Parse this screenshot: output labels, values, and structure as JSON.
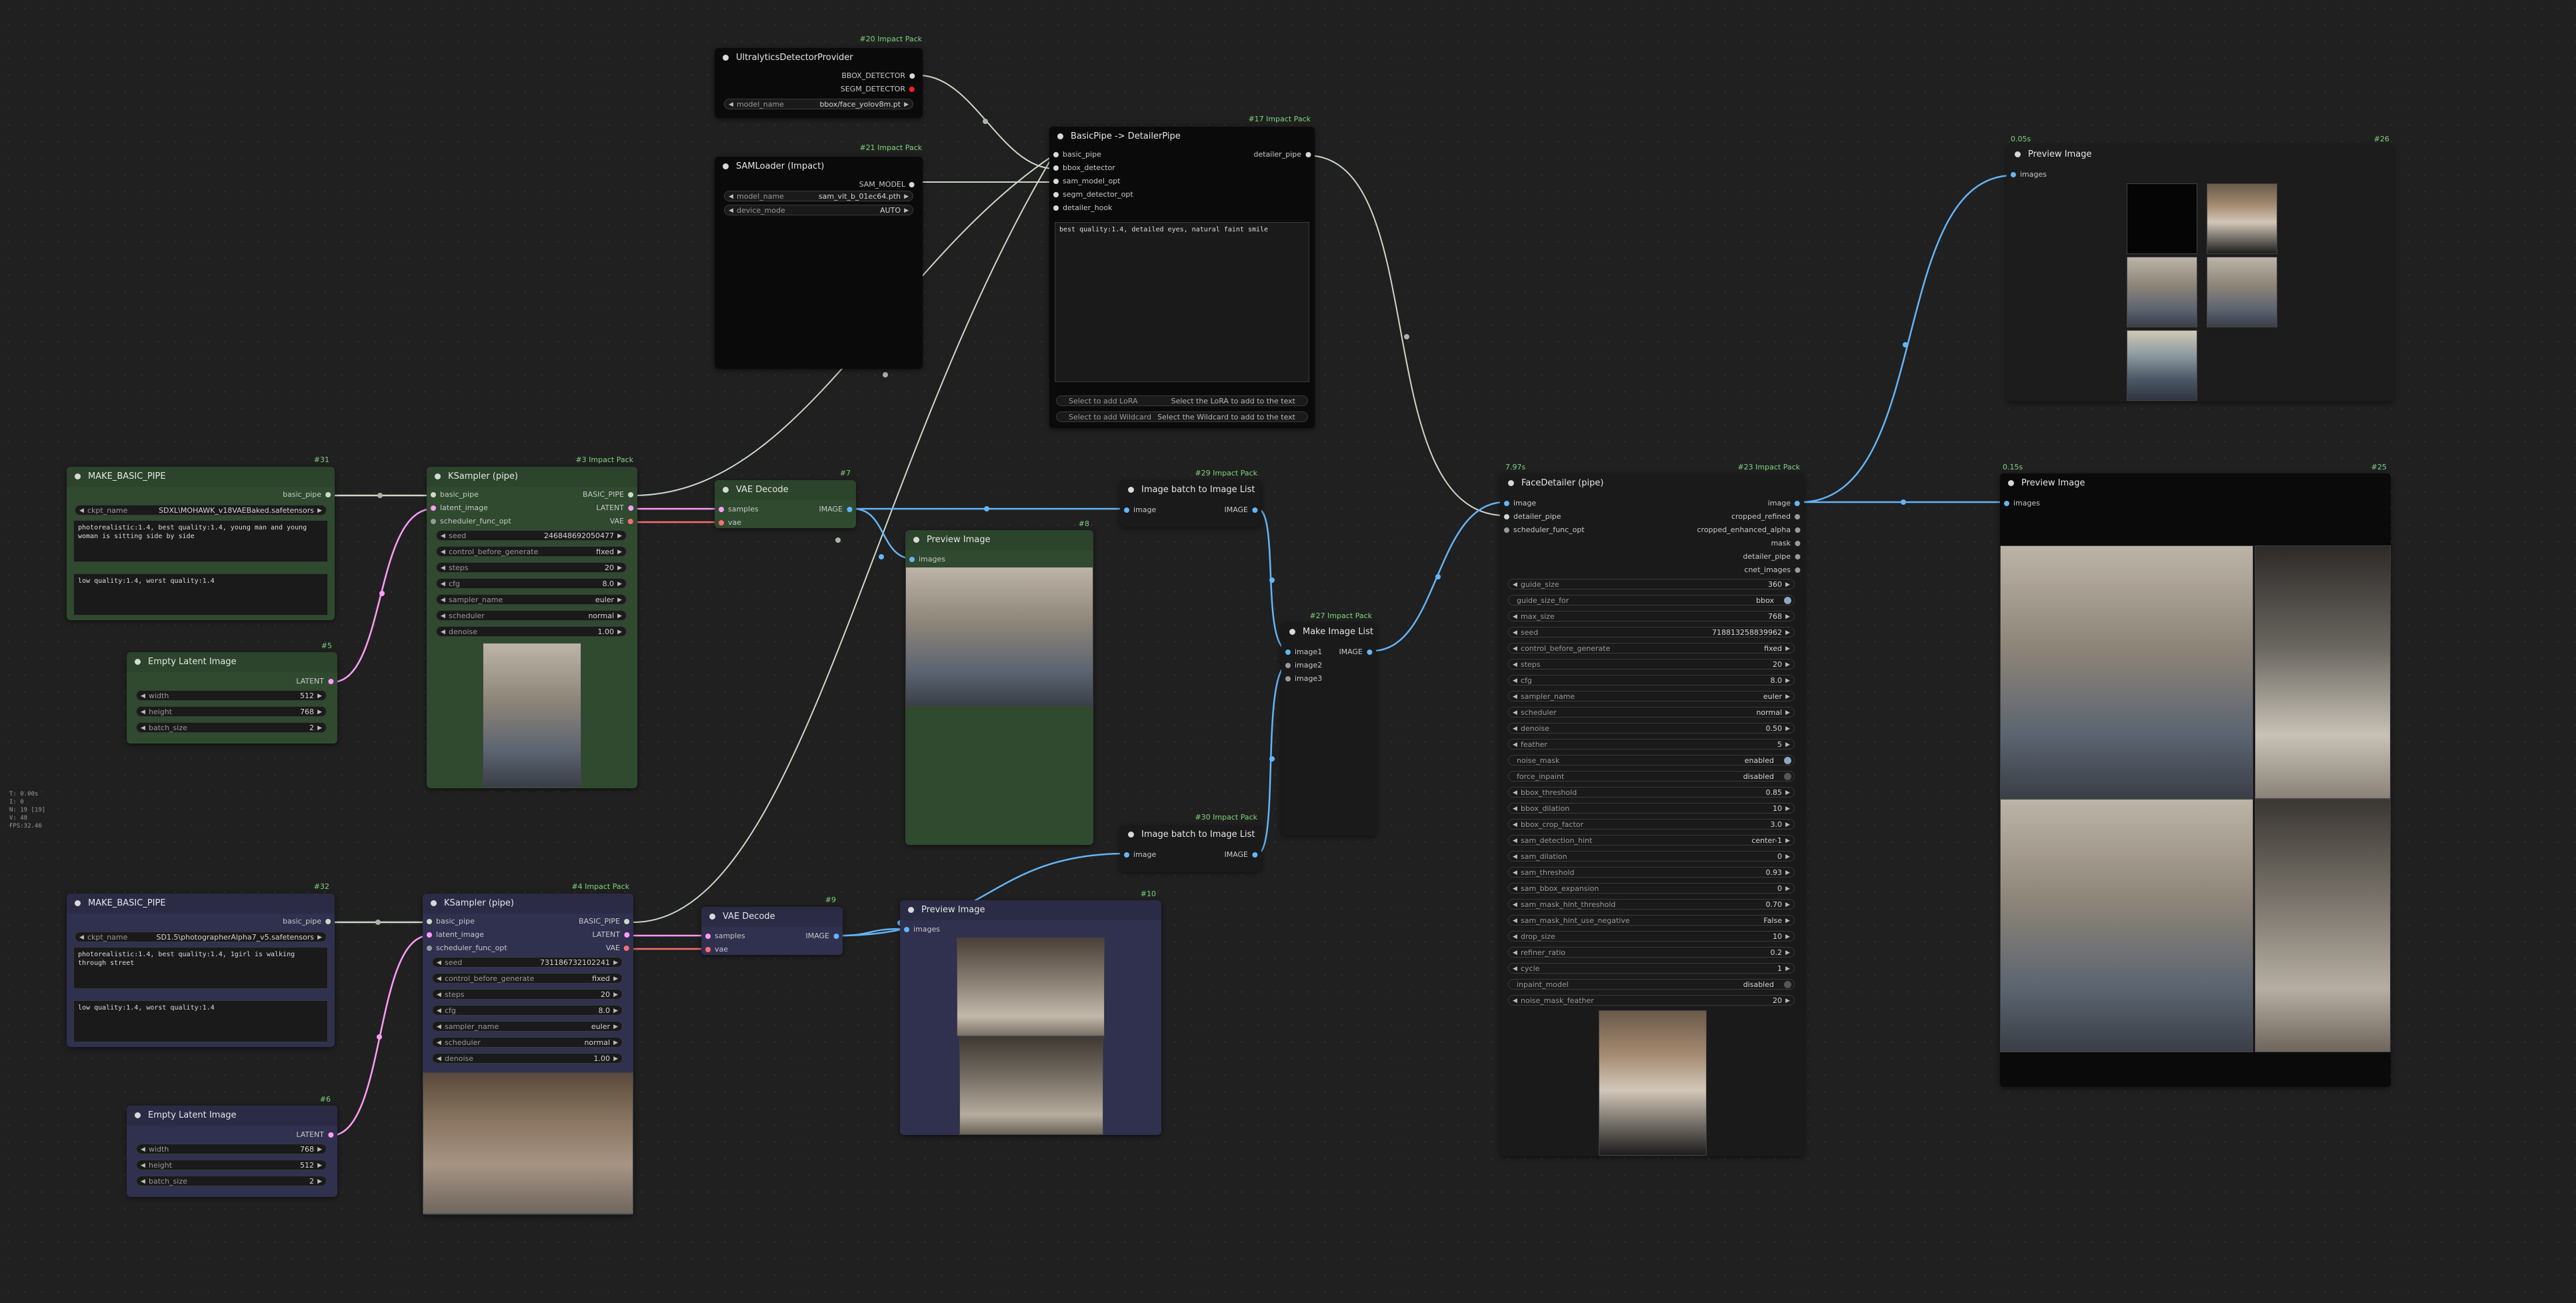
{
  "colors": {
    "green_node": "#2f4a2f",
    "green_title": "#2b442b",
    "blue_node": "#30304f",
    "blue_title": "#2b2b46",
    "black_node": "#0a0a0a",
    "dark_node": "#1a1a1a",
    "link_latent": "#ff9cf9",
    "link_vae": "#ff6e6e",
    "link_image": "#64b5f6",
    "link_pipe": "#cfd8c8",
    "badge": "#7cd67c"
  },
  "stats": [
    "T: 0.00s",
    "I: 0",
    "N: 19 [19]",
    "V: 48",
    "FPS:32.46"
  ],
  "nodes": {
    "ultra": {
      "title": "UltralyticsDetectorProvider",
      "badge": "#20 Impact Pack",
      "out1": "BBOX_DETECTOR",
      "out2": "SEGM_DETECTOR",
      "w_model_l": "model_name",
      "w_model_v": "bbox/face_yolov8m.pt"
    },
    "sam": {
      "title": "SAMLoader (Impact)",
      "badge": "#21 Impact Pack",
      "out1": "SAM_MODEL",
      "w1_l": "model_name",
      "w1_v": "sam_vit_b_01ec64.pth",
      "w2_l": "device_mode",
      "w2_v": "AUTO"
    },
    "bp2dp": {
      "title": "BasicPipe -> DetailerPipe",
      "badge": "#17 Impact Pack",
      "in1": "basic_pipe",
      "in2": "bbox_detector",
      "in3": "sam_model_opt",
      "in4": "segm_detector_opt",
      "in5": "detailer_hook",
      "out1": "detailer_pipe",
      "text": "best quality:1.4, detailed eyes, natural faint smile",
      "b1_l": "Select to add LoRA",
      "b1_r": "Select the LoRA to add to the text",
      "b2_l": "Select to add Wildcard",
      "b2_r": "Select the Wildcard to add to the text"
    },
    "prev26": {
      "time": "0.05s",
      "badge": "#26",
      "title": "Preview Image",
      "in1": "images"
    },
    "mbp31": {
      "title": "MAKE_BASIC_PIPE",
      "badge": "#31",
      "out1": "basic_pipe",
      "w_l": "ckpt_name",
      "w_v": "SDXL\\MOHAWK_v18VAEBaked.safetensors",
      "pos": "photorealistic:1.4, best quality:1.4, young man and young woman is sitting side by side",
      "neg": "low quality:1.4, worst quality:1.4"
    },
    "ks3": {
      "title": "KSampler (pipe)",
      "badge": "#3 Impact Pack",
      "in1": "basic_pipe",
      "in2": "latent_image",
      "in3": "scheduler_func_opt",
      "out1": "BASIC_PIPE",
      "out2": "LATENT",
      "out3": "VAE",
      "widgets": [
        [
          "seed",
          "246848692050477"
        ],
        [
          "control_before_generate",
          "fixed"
        ],
        [
          "steps",
          "20"
        ],
        [
          "cfg",
          "8.0"
        ],
        [
          "sampler_name",
          "euler"
        ],
        [
          "scheduler",
          "normal"
        ],
        [
          "denoise",
          "1.00"
        ]
      ]
    },
    "vae7": {
      "title": "VAE Decode",
      "badge": "#7",
      "in1": "samples",
      "in2": "vae",
      "out1": "IMAGE"
    },
    "prev8": {
      "title": "Preview Image",
      "badge": "#8",
      "in1": "images"
    },
    "ib29": {
      "title": "Image batch to Image List",
      "badge": "#29 Impact Pack",
      "in1": "image",
      "out1": "IMAGE"
    },
    "mil27": {
      "title": "Make Image List",
      "badge": "#27 Impact Pack",
      "in1": "image1",
      "in2": "image2",
      "in3": "image3",
      "out1": "IMAGE"
    },
    "ib30": {
      "title": "Image batch to Image List",
      "badge": "#30 Impact Pack",
      "in1": "image",
      "out1": "IMAGE"
    },
    "fd23": {
      "time": "7.97s",
      "title": "FaceDetailer (pipe)",
      "badge": "#23 Impact Pack",
      "in1": "image",
      "in2": "detailer_pipe",
      "in3": "scheduler_func_opt",
      "outs": [
        "image",
        "cropped_refined",
        "cropped_enhanced_alpha",
        "mask",
        "detailer_pipe",
        "cnet_images"
      ],
      "widgets": [
        [
          "guide_size",
          "360",
          "n"
        ],
        [
          "guide_size_for",
          "bbox",
          "t"
        ],
        [
          "max_size",
          "768",
          "n"
        ],
        [
          "seed",
          "718813258839962",
          "n"
        ],
        [
          "control_before_generate",
          "fixed",
          "n"
        ],
        [
          "steps",
          "20",
          "n"
        ],
        [
          "cfg",
          "8.0",
          "n"
        ],
        [
          "sampler_name",
          "euler",
          "n"
        ],
        [
          "scheduler",
          "normal",
          "n"
        ],
        [
          "denoise",
          "0.50",
          "n"
        ],
        [
          "feather",
          "5",
          "n"
        ],
        [
          "noise_mask",
          "enabled",
          "t"
        ],
        [
          "force_inpaint",
          "disabled",
          "t0"
        ],
        [
          "bbox_threshold",
          "0.85",
          "n"
        ],
        [
          "bbox_dilation",
          "10",
          "n"
        ],
        [
          "bbox_crop_factor",
          "3.0",
          "n"
        ],
        [
          "sam_detection_hint",
          "center-1",
          "n"
        ],
        [
          "sam_dilation",
          "0",
          "n"
        ],
        [
          "sam_threshold",
          "0.93",
          "n"
        ],
        [
          "sam_bbox_expansion",
          "0",
          "n"
        ],
        [
          "sam_mask_hint_threshold",
          "0.70",
          "n"
        ],
        [
          "sam_mask_hint_use_negative",
          "False",
          "n"
        ],
        [
          "drop_size",
          "10",
          "n"
        ],
        [
          "refiner_ratio",
          "0.2",
          "n"
        ],
        [
          "cycle",
          "1",
          "n"
        ],
        [
          "inpaint_model",
          "disabled",
          "t0"
        ],
        [
          "noise_mask_feather",
          "20",
          "n"
        ]
      ]
    },
    "prev25": {
      "time": "0.15s",
      "badge": "#25",
      "title": "Preview Image",
      "in1": "images"
    },
    "latent5": {
      "title": "Empty Latent Image",
      "badge": "#5",
      "out1": "LATENT",
      "widgets": [
        [
          "width",
          "512"
        ],
        [
          "height",
          "768"
        ],
        [
          "batch_size",
          "2"
        ]
      ]
    },
    "mbp32": {
      "title": "MAKE_BASIC_PIPE",
      "badge": "#32",
      "out1": "basic_pipe",
      "w_l": "ckpt_name",
      "w_v": "SD1.5\\photographerAlpha7_v5.safetensors",
      "pos": "photorealistic:1.4, best quality:1.4, 1girl is walking through street",
      "neg": "low quality:1.4, worst quality:1.4"
    },
    "ks4": {
      "title": "KSampler (pipe)",
      "badge": "#4 Impact Pack",
      "in1": "basic_pipe",
      "in2": "latent_image",
      "in3": "scheduler_func_opt",
      "out1": "BASIC_PIPE",
      "out2": "LATENT",
      "out3": "VAE",
      "widgets": [
        [
          "seed",
          "731186732102241"
        ],
        [
          "control_before_generate",
          "fixed"
        ],
        [
          "steps",
          "20"
        ],
        [
          "cfg",
          "8.0"
        ],
        [
          "sampler_name",
          "euler"
        ],
        [
          "scheduler",
          "normal"
        ],
        [
          "denoise",
          "1.00"
        ]
      ]
    },
    "vae9": {
      "title": "VAE Decode",
      "badge": "#9",
      "in1": "samples",
      "in2": "vae",
      "out1": "IMAGE"
    },
    "prev10": {
      "title": "Preview Image",
      "badge": "#10",
      "in1": "images"
    },
    "latent6": {
      "title": "Empty Latent Image",
      "badge": "#6",
      "out1": "LATENT",
      "widgets": [
        [
          "width",
          "768"
        ],
        [
          "height",
          "512"
        ],
        [
          "batch_size",
          "2"
        ]
      ]
    }
  }
}
